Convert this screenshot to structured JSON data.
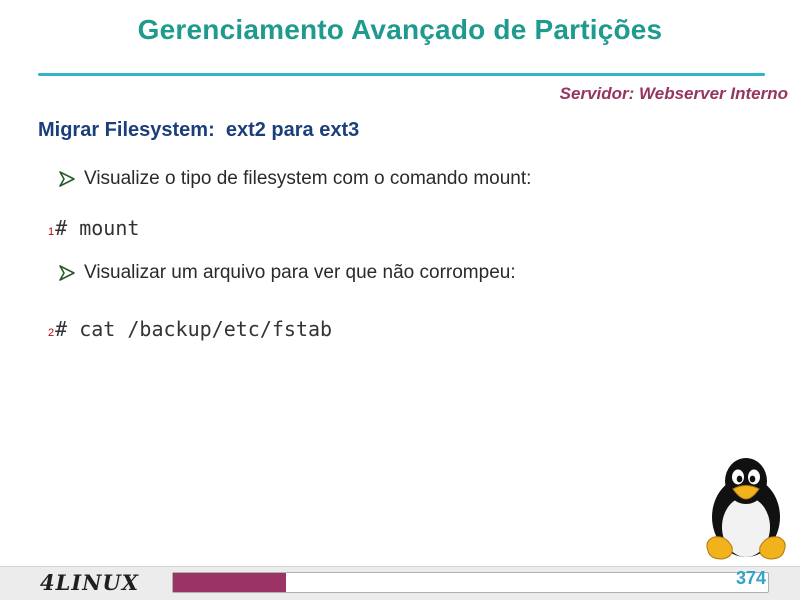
{
  "slide": {
    "title": "Gerenciamento Avançado de Partições",
    "server_label": "Servidor: Webserver Interno",
    "heading": "Migrar Filesystem:  ext2 para ext3",
    "bullets": [
      "Visualize o tipo de filesystem com o comando mount:",
      "Visualizar um arquivo para ver que não corrompeu:"
    ],
    "commands": [
      {
        "number": "1",
        "text": "# mount"
      },
      {
        "number": "2",
        "text": "# cat /backup/etc/fstab"
      }
    ]
  },
  "footer": {
    "logo_text": "4LINUX",
    "page_number": "374",
    "progress": 0.19,
    "progress_color": "#9b3465"
  },
  "colors": {
    "title": "#1f9a8f",
    "rule": "#30b4c6",
    "server": "#96355f",
    "heading": "#1a3f7a",
    "line_number": "#c00000",
    "page_number": "#30a3c6"
  },
  "icons": {
    "bullet": "arrowhead-bullet-icon",
    "mascot": "tux-penguin-icon"
  }
}
